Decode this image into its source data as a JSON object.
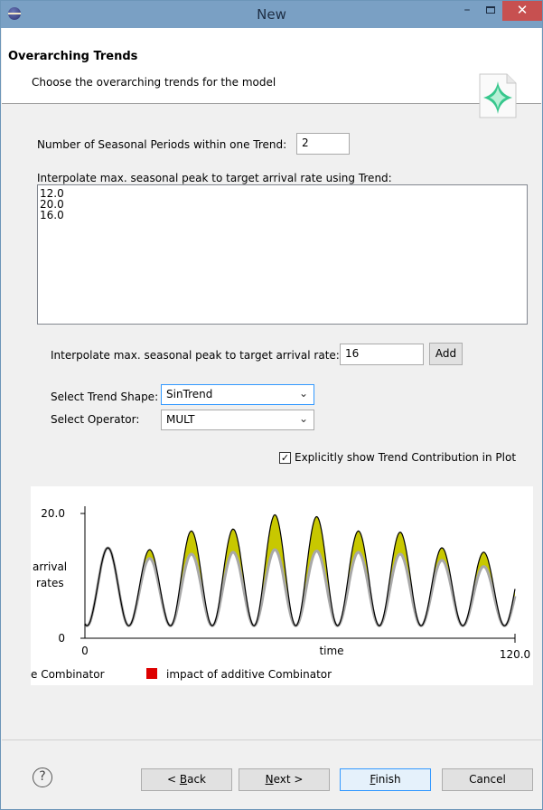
{
  "window": {
    "title": "New",
    "minimize_glyph": "–",
    "close_glyph": "✕"
  },
  "header": {
    "title": "Overarching Trends",
    "description": "Choose the overarching trends for the model"
  },
  "form": {
    "seasonal_periods_label": "Number of Seasonal Periods within one Trend:",
    "seasonal_periods_value": "2",
    "trend_list_label": "Interpolate max. seasonal peak to target arrival rate using Trend:",
    "trend_list_items": [
      "12.0",
      "20.0",
      "16.0"
    ],
    "peak_label": "Interpolate max. seasonal peak to target arrival rate:",
    "peak_value": "16",
    "add_button": "Add",
    "trend_shape_label": "Select Trend Shape:",
    "trend_shape_value": "SinTrend",
    "operator_label": "Select Operator:",
    "operator_value": "MULT",
    "show_trend_label": "Explicitly show Trend Contribution in Plot",
    "show_trend_checked": true,
    "check_glyph": "✓",
    "chevron_glyph": "⌄"
  },
  "chart_data": {
    "type": "area",
    "ylabel": "arrival rates",
    "xlabel": "time",
    "xlim": [
      0,
      120
    ],
    "ylim": [
      0,
      20
    ],
    "x_ticks": [
      "0",
      "120.0"
    ],
    "y_ticks": [
      "0",
      "20.0"
    ],
    "num_peaks": 10,
    "peak_values_total": [
      14.5,
      14.2,
      17.2,
      17.5,
      19.8,
      19.5,
      17.2,
      17.0,
      14.5,
      13.8
    ],
    "peak_values_seasonal": [
      14.5,
      12.8,
      13.5,
      13.8,
      14.2,
      14.0,
      13.8,
      13.5,
      12.5,
      11.5
    ],
    "trough_value": 2.0,
    "legend": [
      "e Combinator",
      "impact of additive Combinator"
    ],
    "colors": {
      "seasonal_line": "#000000",
      "seasonal_fill": "#a8a8a8",
      "trend_fill": "#c8c800",
      "additive_legend": "#dd0000"
    }
  },
  "footer": {
    "help_glyph": "?",
    "back_prefix": "< ",
    "back_mnemonic": "B",
    "back_rest": "ack",
    "next_mnemonic": "N",
    "next_rest": "ext >",
    "finish_mnemonic": "F",
    "finish_rest": "inish",
    "cancel": "Cancel"
  }
}
